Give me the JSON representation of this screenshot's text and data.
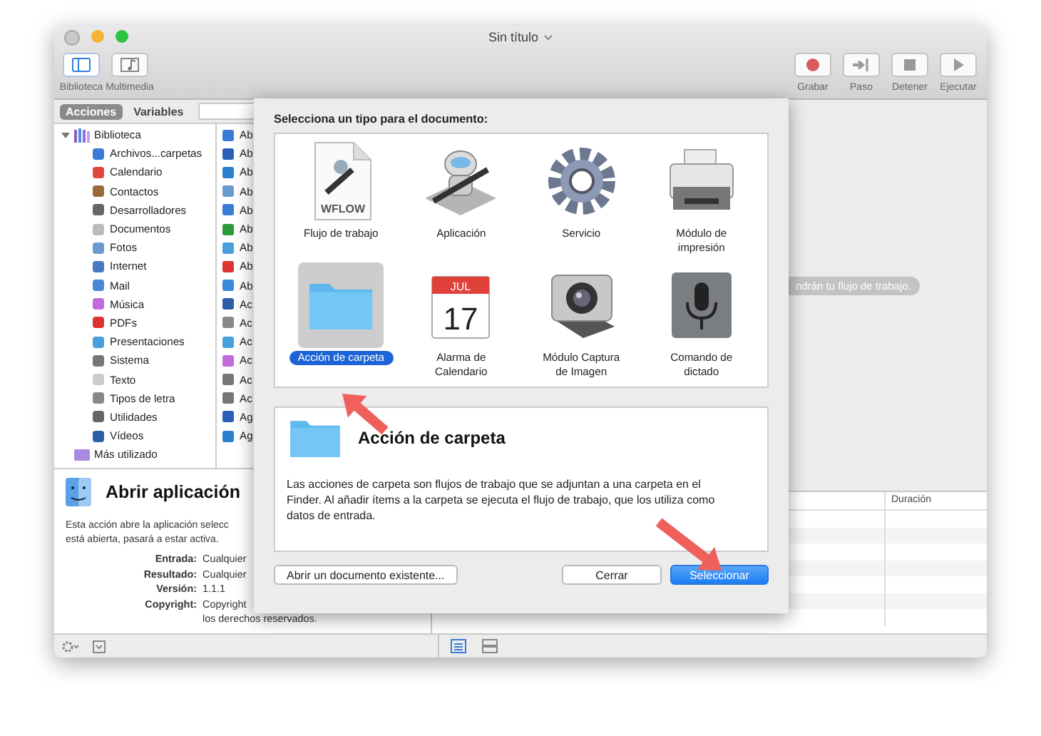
{
  "window": {
    "title": "Sin título"
  },
  "toolbar": {
    "left": [
      {
        "label": "Biblioteca",
        "kind": "library",
        "selected": true
      },
      {
        "label": "Multimedia",
        "kind": "media",
        "selected": false
      }
    ],
    "right": [
      {
        "label": "Grabar",
        "kind": "record"
      },
      {
        "label": "Paso",
        "kind": "step"
      },
      {
        "label": "Detener",
        "kind": "stop"
      },
      {
        "label": "Ejecutar",
        "kind": "run"
      }
    ]
  },
  "library_tabs": [
    {
      "label": "Acciones",
      "selected": true
    },
    {
      "label": "Variables",
      "selected": false
    }
  ],
  "library": [
    {
      "label": "Biblioteca",
      "expanded": true,
      "children": [
        {
          "label": "Archivos...carpetas"
        },
        {
          "label": "Calendario"
        },
        {
          "label": "Contactos"
        },
        {
          "label": "Desarrolladores"
        },
        {
          "label": "Documentos"
        },
        {
          "label": "Fotos"
        },
        {
          "label": "Internet"
        },
        {
          "label": "Mail"
        },
        {
          "label": "Música"
        },
        {
          "label": "PDFs"
        },
        {
          "label": "Presentaciones"
        },
        {
          "label": "Sistema"
        },
        {
          "label": "Texto"
        },
        {
          "label": "Tipos de letra"
        },
        {
          "label": "Utilidades"
        },
        {
          "label": "Vídeos"
        }
      ]
    },
    {
      "label": "Más utilizado"
    }
  ],
  "actions": [
    "Ab",
    "Ab",
    "Ab",
    "Ab",
    "Ab",
    "Ab",
    "Ab",
    "Ab",
    "Ab",
    "Ac",
    "Ac",
    "Ac",
    "Ac",
    "Ac",
    "Ac",
    "Ag",
    "Ag"
  ],
  "description": {
    "title": "Abrir aplicación",
    "lines": [
      "Esta acción abre la aplicación selecc",
      "está abierta, pasará a estar activa."
    ],
    "details": [
      {
        "label": "Entrada:",
        "lines": [
          "Cualquier"
        ]
      },
      {
        "label": "Resultado:",
        "lines": [
          "Cualquier"
        ]
      },
      {
        "label": "Versión:",
        "lines": [
          "1.1.1"
        ]
      },
      {
        "label": "Copyright:",
        "lines": [
          "Copyright",
          "los derechos reservados."
        ]
      }
    ]
  },
  "workflow_hint": "ndrán tu flujo de trabajo.",
  "log": {
    "columns": [
      "",
      "Duración"
    ]
  },
  "sheet": {
    "prompt": "Selecciona un tipo para el documento:",
    "types": [
      {
        "label": "Flujo de trabajo",
        "kind": "workflow",
        "icon_texts": [
          "WFLOW"
        ],
        "selected": false
      },
      {
        "label": "Aplicación",
        "kind": "application",
        "selected": false
      },
      {
        "label": "Servicio",
        "kind": "service",
        "selected": false
      },
      {
        "label": "Módulo de impresión",
        "kind": "print",
        "selected": false
      },
      {
        "label": "Acción de carpeta",
        "kind": "folder",
        "selected": true
      },
      {
        "label": "Alarma de Calendario",
        "kind": "calendar",
        "icon_texts": [
          "JUL",
          "17"
        ],
        "selected": false
      },
      {
        "label": "Módulo Captura de Imagen",
        "kind": "capture",
        "selected": false
      },
      {
        "label": "Comando de dictado",
        "kind": "dictation",
        "selected": false
      }
    ],
    "detail": {
      "title": "Acción de carpeta",
      "text": "Las acciones de carpeta son flujos de trabajo que se adjuntan a una carpeta en el Finder. Al añadir ítems a la carpeta se ejecuta el flujo de trabajo, que los utiliza como datos de entrada."
    },
    "buttons": [
      {
        "label": "Abrir un documento existente...",
        "kind": "secondary"
      },
      {
        "label": "Cerrar",
        "kind": "normal"
      },
      {
        "label": "Seleccionar",
        "kind": "default"
      }
    ]
  }
}
